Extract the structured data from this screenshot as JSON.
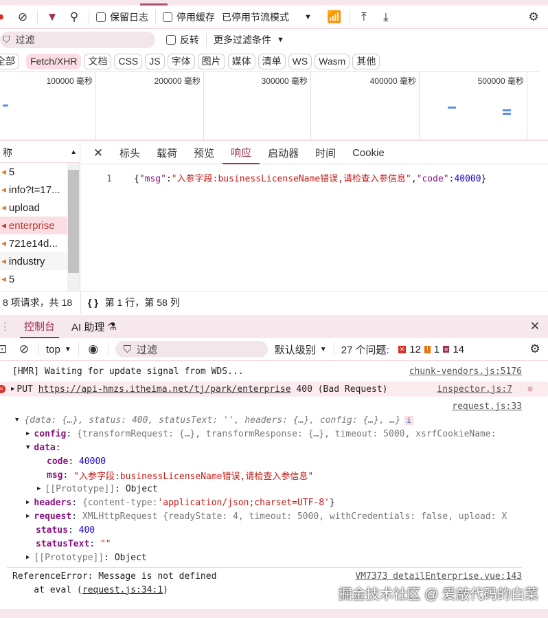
{
  "toolbar": {
    "preserve_log": "保留日志",
    "disable_cache": "停用缓存",
    "throttling": "已停用节流模式"
  },
  "filter": {
    "placeholder": "过滤",
    "invert": "反转",
    "more": "更多过滤条件"
  },
  "types": [
    "全部",
    "Fetch/XHR",
    "文档",
    "CSS",
    "JS",
    "字体",
    "图片",
    "媒体",
    "清单",
    "WS",
    "Wasm",
    "其他"
  ],
  "timeline": [
    "100000 毫秒",
    "200000 毫秒",
    "300000 毫秒",
    "400000 毫秒",
    "500000 毫秒"
  ],
  "requests": {
    "header": "称",
    "items": [
      "5",
      "info?t=17...",
      "upload",
      "enterprise",
      "721e14d...",
      "industry",
      "5"
    ],
    "footer": "8 项请求，共 18"
  },
  "detail": {
    "tabs": [
      "标头",
      "载荷",
      "预览",
      "响应",
      "启动器",
      "时间",
      "Cookie"
    ],
    "line_no": "1",
    "resp_open": "{",
    "k1": "\"msg\"",
    "v1": "\"入参字段:businessLicenseName错误,请检查入参信息\"",
    "k2": "\"code\"",
    "v2": "40000",
    "resp_close": "}",
    "cursor": "第 1 行，第 58 列"
  },
  "drawer": {
    "tabs": [
      "控制台",
      "AI 助理"
    ]
  },
  "console_toolbar": {
    "context": "top",
    "filter": "过滤",
    "level": "默认级别",
    "issues": "27 个问题:",
    "err_count": "12",
    "warn_count": "1",
    "info_count": "14"
  },
  "console": {
    "hmr": "[HMR] Waiting for update signal from WDS...",
    "hmr_src": "chunk-vendors.js:5176",
    "put_method": "PUT",
    "put_url": "https://api-hmzs.itheima.net/tj/park/enterprise",
    "put_status": "400 (Bad Request)",
    "put_src": "inspector.js:7",
    "req_src": "request.js:33",
    "obj_summary": "{data: {…}, status: 400, statusText: '', headers: {…}, config: {…},  …}",
    "config_k": "config",
    "config_v": "{transformRequest: {…}, transformResponse: {…}, timeout: 5000, xsrfCookieName:",
    "data_k": "data",
    "code_k": "code",
    "code_v": "40000",
    "msg_k": "msg",
    "msg_v": "\"入参字段:businessLicenseName错误,请检查入参信息\"",
    "proto1": "[[Prototype]]",
    "proto_v": "Object",
    "headers_k": "headers",
    "headers_v1": "{content-type: ",
    "headers_v2": "'application/json;charset=UTF-8'",
    "headers_v3": "}",
    "request_k": "request",
    "request_v": "XMLHttpRequest  {readyState: 4, timeout: 5000, withCredentials: false, upload: X",
    "status_k": "status",
    "status_v": "400",
    "statusText_k": "statusText",
    "statusText_v": "\"\"",
    "proto2": "[[Prototype]]",
    "ref_err": "ReferenceError: Message is not defined",
    "ref_src": "VM7373 detailEnterprise.vue:143",
    "at_eval": "    at eval (",
    "at_link": "request.js:34:1",
    "at_close": ")"
  },
  "watermark": "掘金技术社区 @ 爱敲代码的白菜"
}
